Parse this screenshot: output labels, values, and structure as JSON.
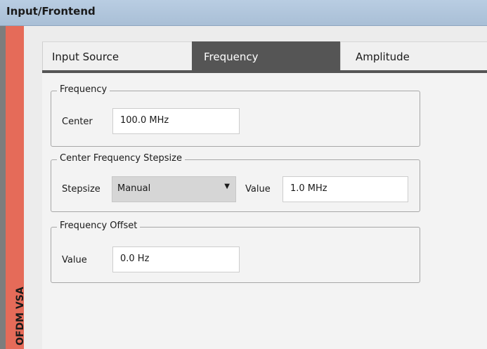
{
  "window": {
    "title": "Input/Frontend"
  },
  "side_tab": {
    "label": "OFDM VSA"
  },
  "tabs": [
    {
      "label": "Input Source",
      "active": false
    },
    {
      "label": "Frequency",
      "active": true
    },
    {
      "label": "Amplitude",
      "active": false
    }
  ],
  "frequency_group": {
    "title": "Frequency",
    "center_label": "Center",
    "center_value": "100.0 MHz"
  },
  "stepsize_group": {
    "title": "Center Frequency Stepsize",
    "stepsize_label": "Stepsize",
    "stepsize_selected": "Manual",
    "value_label": "Value",
    "value": "1.0 MHz"
  },
  "offset_group": {
    "title": "Frequency Offset",
    "value_label": "Value",
    "value": "0.0 Hz"
  },
  "colors": {
    "active_tab": "#555555",
    "side_tab": "#e56b59",
    "title_bar": "#b3c8df"
  },
  "icons": {
    "dropdown": "chevron-down-icon"
  }
}
